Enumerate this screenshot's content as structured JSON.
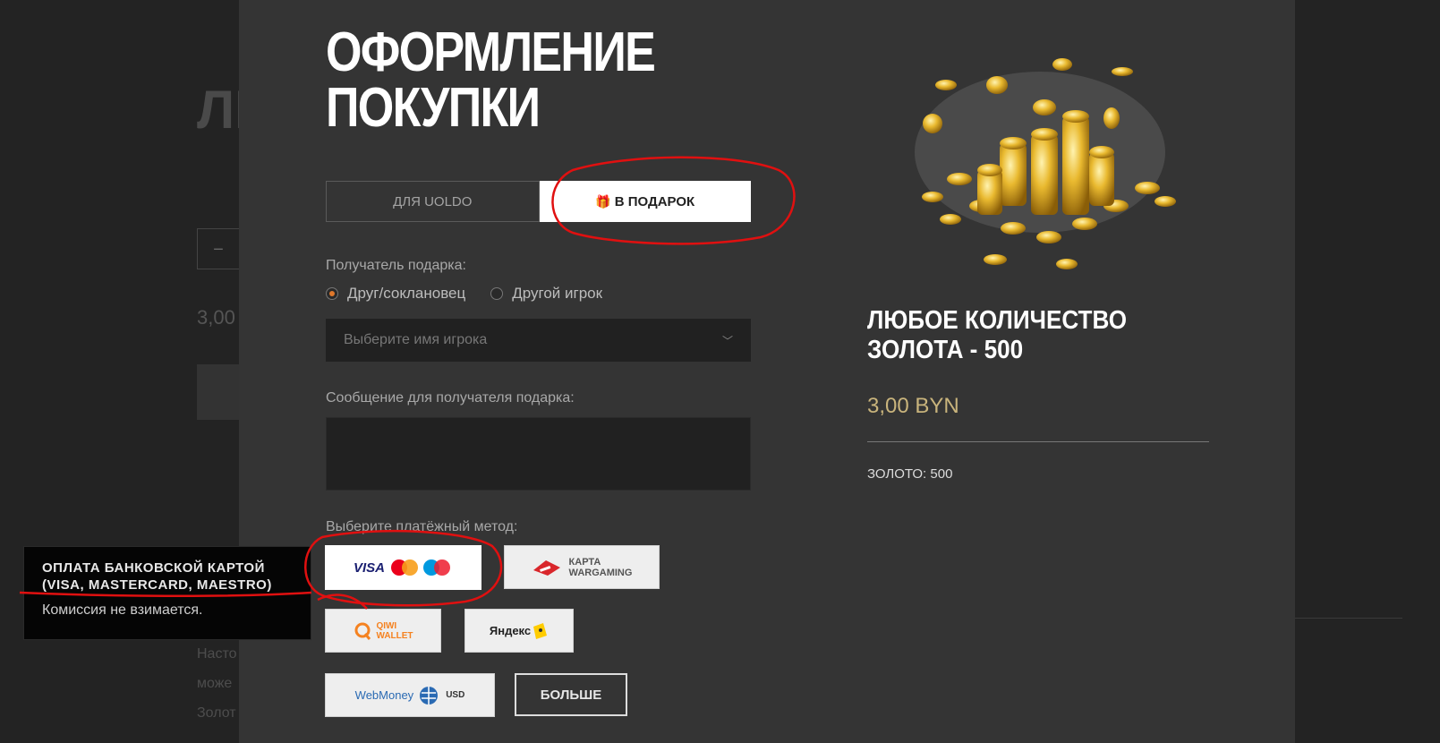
{
  "background": {
    "title_fragment": "ЛЮ ЗО",
    "qty_minus": "−",
    "price_fragment": "3,00",
    "text_lines": [
      "Насто",
      "може",
      "Золот"
    ]
  },
  "modal": {
    "title_line1": "ОФОРМЛЕНИЕ",
    "title_line2": "ПОКУПКИ",
    "tabs": {
      "self": "ДЛЯ UOLDO",
      "gift": "В ПОДАРОК"
    },
    "recipient_label": "Получатель подарка:",
    "recipient_options": [
      "Друг/соклановец",
      "Другой игрок"
    ],
    "recipient_selected": 0,
    "player_select_placeholder": "Выберите имя игрока",
    "message_label": "Сообщение для получателя подарка:",
    "payment_label": "Выберите платёжный метод:",
    "payment_methods": {
      "card": "VISA",
      "wargaming_line1": "КАРТА",
      "wargaming_line2": "WARGAMING",
      "qiwi_line1": "QIWI",
      "qiwi_line2": "WALLET",
      "yandex": "Яндекс",
      "webmoney": "WebMoney",
      "webmoney_currency": "USD"
    },
    "more_button": "БОЛЬШЕ"
  },
  "product": {
    "name_line1": "ЛЮБОЕ КОЛИЧЕСТВО",
    "name_line2": "ЗОЛОТА - 500",
    "price": "3,00 BYN",
    "detail": "ЗОЛОТО: 500"
  },
  "tooltip": {
    "title_line1": "ОПЛАТА БАНКОВСКОЙ КАРТОЙ",
    "title_line2": "(VISA, MASTERCARD, MAESTRO)",
    "subtitle": "Комиссия не взимается."
  },
  "colors": {
    "modal_bg": "#343434",
    "price_gold": "#c9b47c",
    "radio_accent": "#e0782b",
    "annotation_red": "#e01010"
  }
}
